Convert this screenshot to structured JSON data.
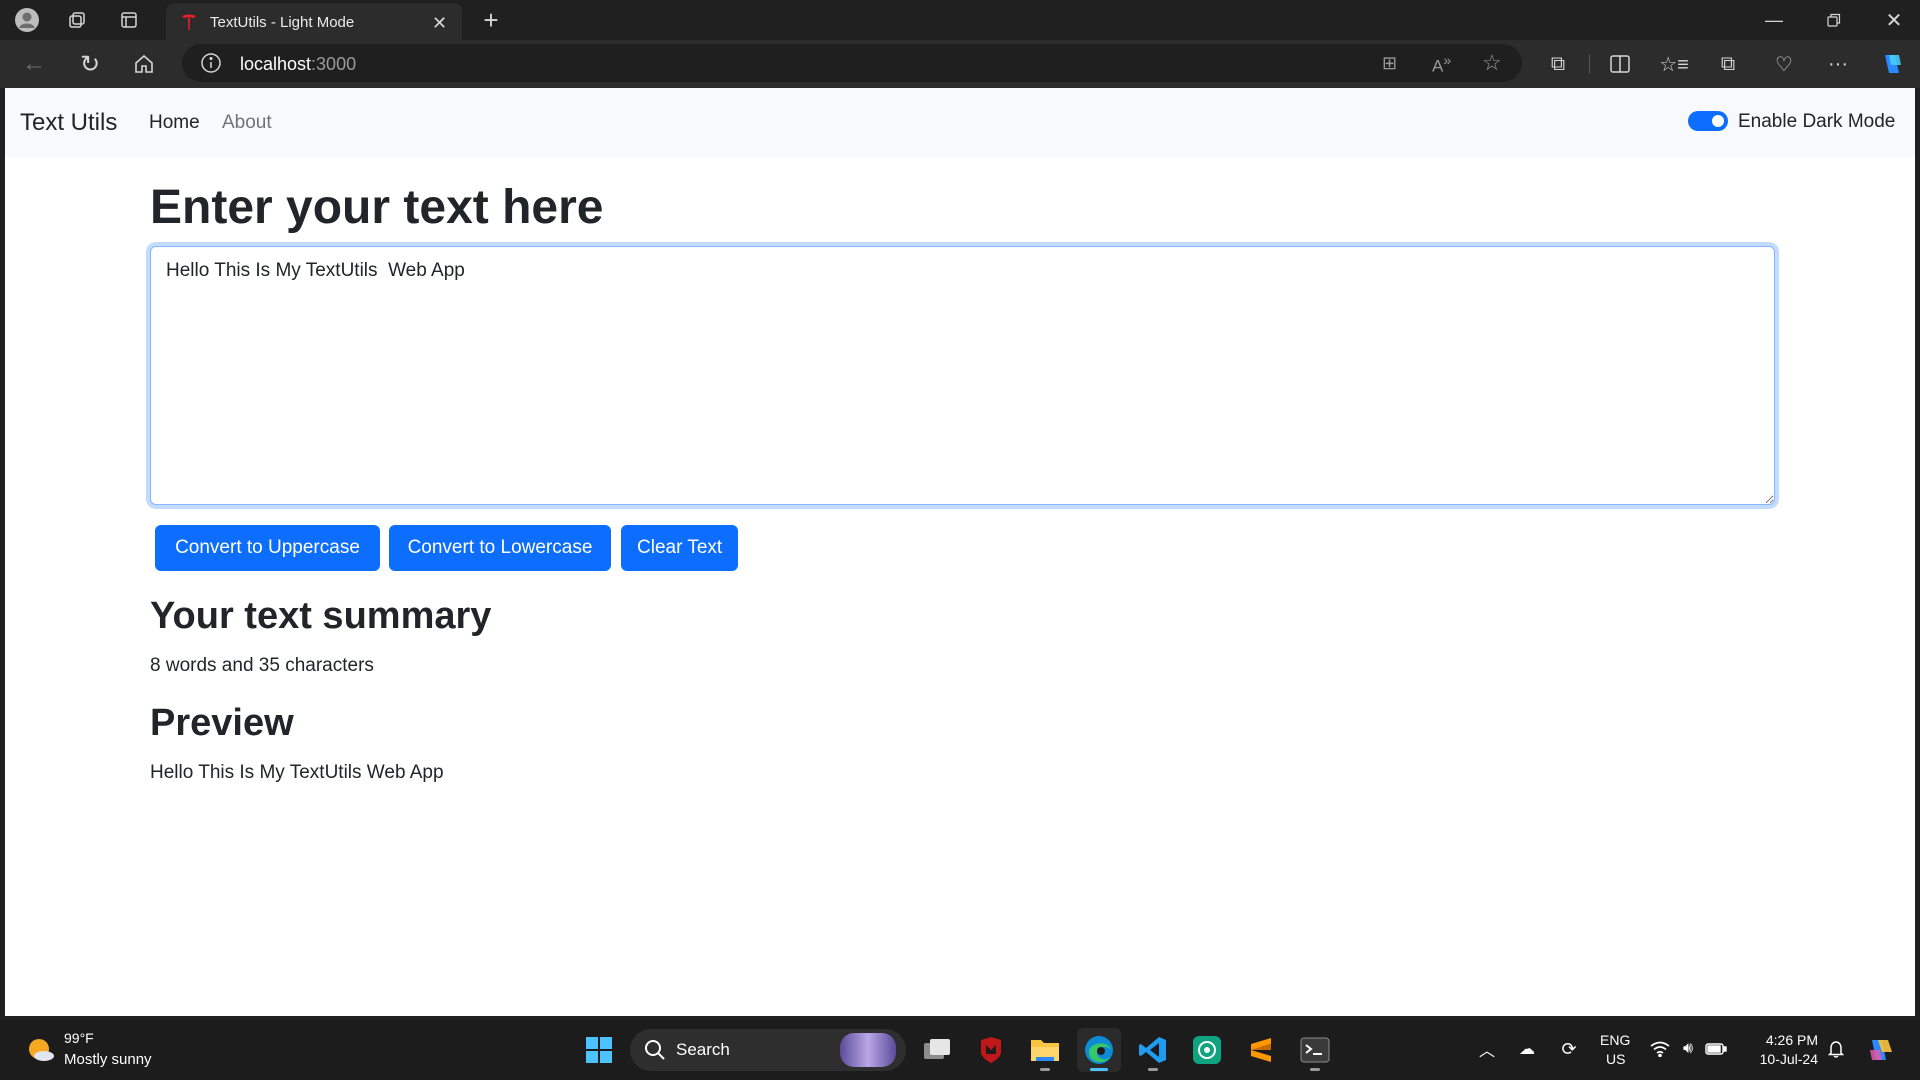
{
  "browser": {
    "tab_title": "TextUtils - Light Mode",
    "url_host": "localhost",
    "url_port": ":3000"
  },
  "navbar": {
    "brand": "Text Utils",
    "links": [
      "Home",
      "About"
    ],
    "dark_mode_label": "Enable Dark Mode",
    "dark_mode_enabled": true
  },
  "main": {
    "heading": "Enter your text here",
    "textarea_value": "Hello This Is My TextUtils  Web App",
    "buttons": {
      "uppercase": "Convert to Uppercase",
      "lowercase": "Convert to Lowercase",
      "clear": "Clear Text"
    },
    "summary_heading": "Your text summary",
    "summary_text": "8 words and 35 characters",
    "preview_heading": "Preview",
    "preview_text": "Hello This Is My TextUtils Web App"
  },
  "colors": {
    "primary": "#0d6efd",
    "navbar_bg": "#f8f9fa",
    "text": "#212529",
    "muted": "#6c757d"
  },
  "taskbar": {
    "weather_temp": "99°F",
    "weather_desc": "Mostly sunny",
    "search_label": "Search",
    "language_top": "ENG",
    "language_bottom": "US",
    "time": "4:26 PM",
    "date": "10-Jul-24",
    "apps": [
      "task-view-icon",
      "mcafee-icon",
      "file-explorer-icon",
      "edge-icon",
      "vscode-icon",
      "chatgpt-icon",
      "sublime-icon",
      "terminal-icon"
    ]
  }
}
